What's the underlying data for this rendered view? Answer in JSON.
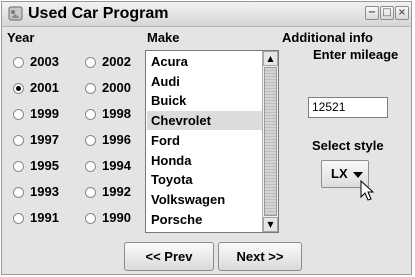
{
  "window": {
    "title": "Used Car Program",
    "controls": {
      "minimize": "−",
      "maximize": "□",
      "close": "×"
    }
  },
  "year": {
    "label": "Year",
    "options": [
      "2003",
      "2002",
      "2001",
      "2000",
      "1999",
      "1998",
      "1997",
      "1996",
      "1995",
      "1994",
      "1993",
      "1992",
      "1991",
      "1990"
    ],
    "selected": "2001"
  },
  "make": {
    "label": "Make",
    "items": [
      "Acura",
      "Audi",
      "Buick",
      "Chevrolet",
      "Ford",
      "Honda",
      "Toyota",
      "Volkswagen",
      "Porsche"
    ],
    "selected": "Chevrolet",
    "scroll_up": "▲",
    "scroll_down": "▼"
  },
  "additional": {
    "heading": "Additional info",
    "mileage_label": "Enter mileage",
    "mileage_value": "12521",
    "style_label": "Select style",
    "style_value": "LX"
  },
  "nav": {
    "prev_label": "<< Prev",
    "next_label": "Next >>"
  },
  "colors": {
    "window_bg": "#e4e4e4",
    "selection": "#dcdcdc"
  }
}
